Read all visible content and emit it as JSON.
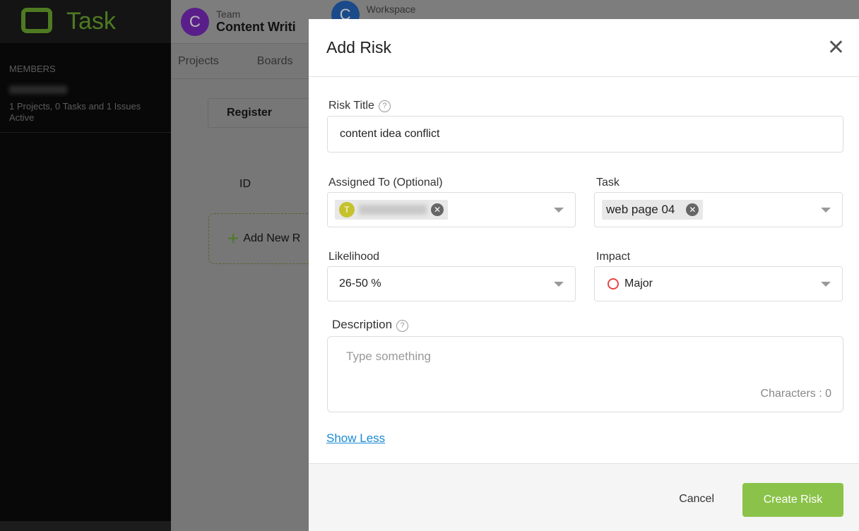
{
  "app": {
    "logo_text": "Task",
    "logo_mark": "N"
  },
  "sidebar": {
    "section": "MEMBERS",
    "member_info": "1 Projects, 0 Tasks and 1 Issues Active"
  },
  "header": {
    "team_label": "Team",
    "team_name": "Content Writi",
    "team_initial": "C",
    "workspace_label": "Workspace",
    "workspace_initial": "C"
  },
  "tabs": [
    "Projects",
    "Boards"
  ],
  "page": {
    "register": "Register",
    "id_col": "ID",
    "add_new": "Add New R"
  },
  "modal": {
    "title": "Add Risk",
    "risk_title_label": "Risk Title",
    "risk_title_value": "content idea conflict",
    "assigned_label": "Assigned To (Optional)",
    "assignee_initial": "T",
    "task_label": "Task",
    "task_value": "web page 04",
    "likelihood_label": "Likelihood",
    "likelihood_value": "26-50 %",
    "impact_label": "Impact",
    "impact_value": "Major",
    "description_label": "Description",
    "description_placeholder": "Type something",
    "characters": "Characters : 0",
    "show_less": "Show Less",
    "cancel": "Cancel",
    "create": "Create Risk"
  },
  "colors": {
    "brand": "#4e7a22",
    "create_button": "#8bc34a",
    "team_avatar": "#5a1e8a",
    "workspace_avatar": "#1a4a8a",
    "impact_major": "#e84545"
  }
}
